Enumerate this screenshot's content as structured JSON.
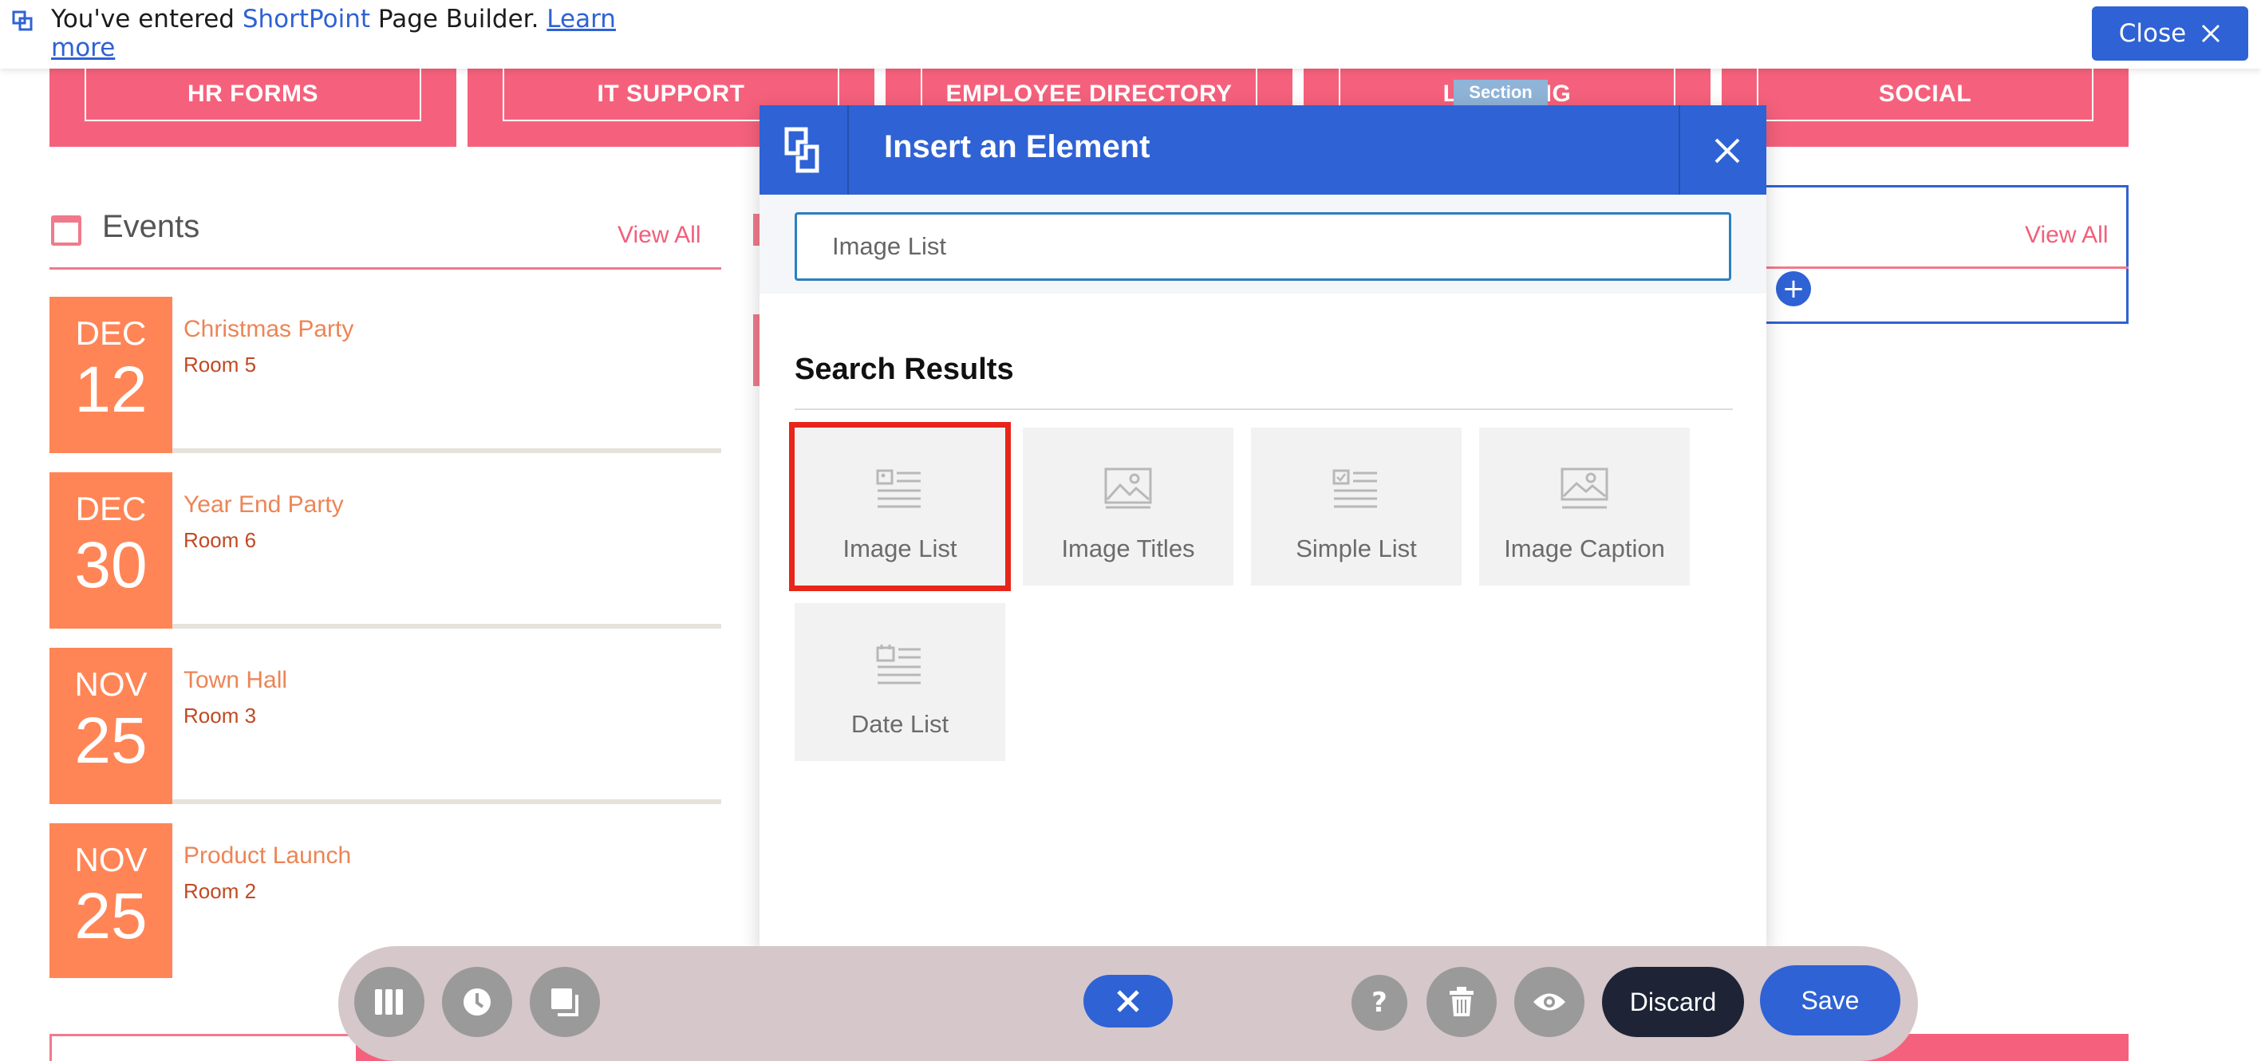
{
  "banner": {
    "prefix": "You've entered",
    "brand": "ShortPoint",
    "suffix": "Page Builder.",
    "link_line1": "Learn",
    "link_line2": "more",
    "close_label": "Close"
  },
  "nav_tiles": [
    "HR FORMS",
    "IT SUPPORT",
    "EMPLOYEE DIRECTORY",
    "LEARNING",
    "SOCIAL"
  ],
  "section_tag": "Section",
  "events": {
    "title": "Events",
    "view_all": "View All",
    "items": [
      {
        "month": "DEC",
        "day": "12",
        "title": "Christmas Party",
        "room": "Room 5"
      },
      {
        "month": "DEC",
        "day": "30",
        "title": "Year End Party",
        "room": "Room 6"
      },
      {
        "month": "NOV",
        "day": "25",
        "title": "Town Hall",
        "room": "Room 3"
      },
      {
        "month": "NOV",
        "day": "25",
        "title": "Product Launch",
        "room": "Room 2"
      }
    ]
  },
  "right_widget": {
    "view_all": "View All"
  },
  "modal": {
    "title": "Insert an Element",
    "search_value": "Image List",
    "results_title": "Search Results",
    "results": [
      {
        "label": "Image List",
        "icon": "image-list-icon",
        "selected": true
      },
      {
        "label": "Image Titles",
        "icon": "image-icon",
        "selected": false
      },
      {
        "label": "Simple List",
        "icon": "simple-list-icon",
        "selected": false
      },
      {
        "label": "Image Caption",
        "icon": "image-caption-icon",
        "selected": false
      },
      {
        "label": "Date List",
        "icon": "date-list-icon",
        "selected": false
      }
    ]
  },
  "toolbar": {
    "discard_label": "Discard",
    "save_label": "Save"
  },
  "colors": {
    "accent": "#2f62d4",
    "pink": "#f5617c",
    "orange": "#ff8556",
    "selected_outline": "#e8251a"
  }
}
